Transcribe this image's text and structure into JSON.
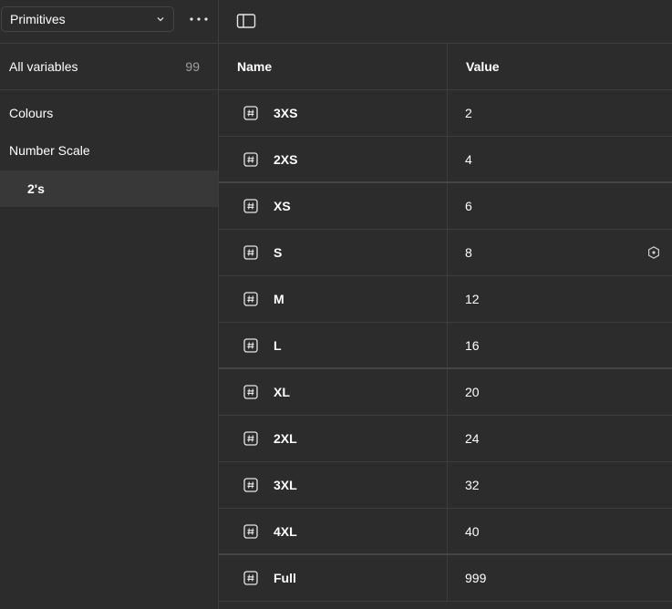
{
  "sidebar": {
    "collection": "Primitives",
    "all_variables_label": "All variables",
    "all_variables_count": "99",
    "groups": [
      {
        "label": "Colours"
      },
      {
        "label": "Number Scale"
      },
      {
        "label": "2's",
        "active": true
      }
    ]
  },
  "table": {
    "headers": {
      "name": "Name",
      "value": "Value"
    },
    "rows": [
      {
        "name": "3XS",
        "value": "2"
      },
      {
        "name": "2XS",
        "value": "4"
      },
      {
        "name": "XS",
        "value": "6"
      },
      {
        "name": "S",
        "value": "8"
      },
      {
        "name": "M",
        "value": "12"
      },
      {
        "name": "L",
        "value": "16"
      },
      {
        "name": "XL",
        "value": "20"
      },
      {
        "name": "2XL",
        "value": "24"
      },
      {
        "name": "3XL",
        "value": "32"
      },
      {
        "name": "4XL",
        "value": "40"
      },
      {
        "name": "Full",
        "value": "999"
      }
    ]
  },
  "icons": {
    "variable_type": "number-hash-icon",
    "more": "more-dots-icon",
    "panel": "sidebar-toggle-icon",
    "mode": "hexagon-mode-icon"
  },
  "colors": {
    "background": "#2c2c2c",
    "active_row": "#383838",
    "divider": "#3d3d3d",
    "muted_text": "#a0a0a0"
  }
}
